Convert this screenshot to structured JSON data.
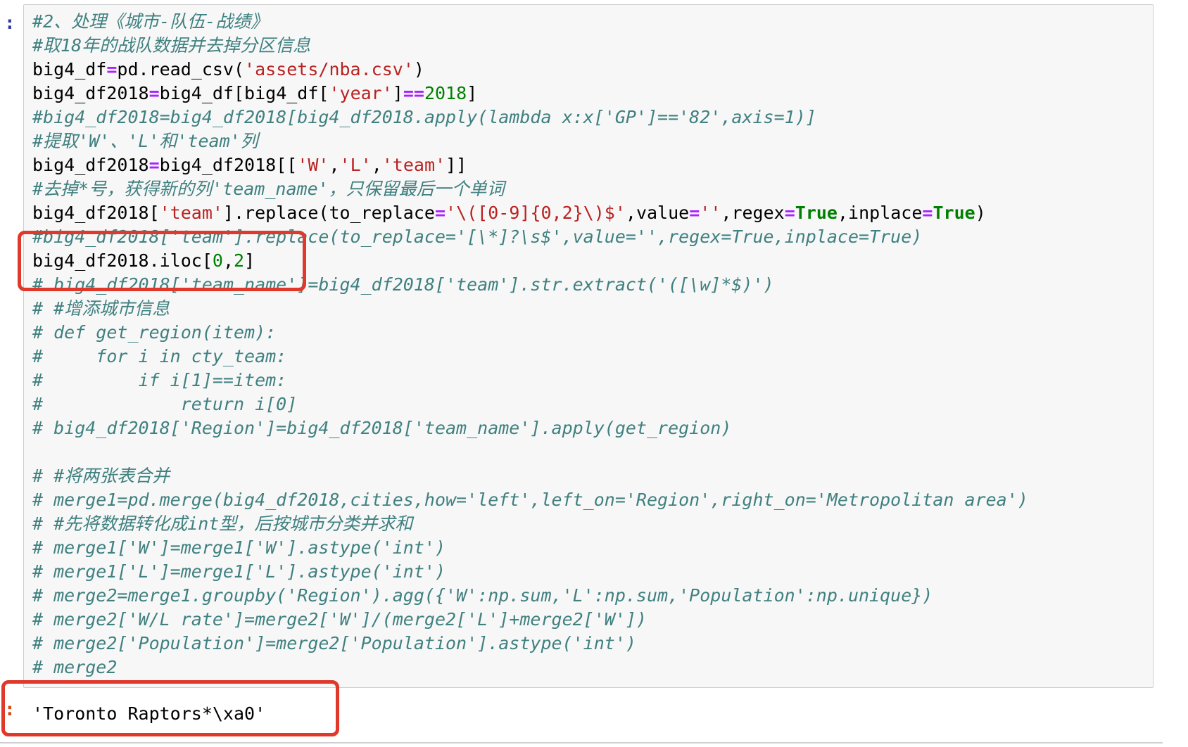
{
  "cell": {
    "input_prompt": ":",
    "output_prompt": ":",
    "output_text": "'Toronto Raptors*\\xa0'"
  },
  "code_lines": [
    [
      {
        "t": "#2、处理《城市-队伍-战绩》",
        "c": "c"
      }
    ],
    [
      {
        "t": "#取18年的战队数据并去掉分区信息",
        "c": "c"
      }
    ],
    [
      {
        "t": "big4_df"
      },
      {
        "t": "=",
        "c": "o"
      },
      {
        "t": "pd.read_csv("
      },
      {
        "t": "'assets/nba.csv'",
        "c": "s"
      },
      {
        "t": ")"
      }
    ],
    [
      {
        "t": "big4_df2018"
      },
      {
        "t": "=",
        "c": "o"
      },
      {
        "t": "big4_df[big4_df["
      },
      {
        "t": "'year'",
        "c": "s"
      },
      {
        "t": "]"
      },
      {
        "t": "==",
        "c": "o"
      },
      {
        "t": "2018",
        "c": "n"
      },
      {
        "t": "]"
      }
    ],
    [
      {
        "t": "#big4_df2018=big4_df2018[big4_df2018.apply(lambda x:x['GP']=='82',axis=1)]",
        "c": "c"
      }
    ],
    [
      {
        "t": "#提取'W'、'L'和'team'列",
        "c": "c"
      }
    ],
    [
      {
        "t": "big4_df2018"
      },
      {
        "t": "=",
        "c": "o"
      },
      {
        "t": "big4_df2018[["
      },
      {
        "t": "'W'",
        "c": "s"
      },
      {
        "t": ","
      },
      {
        "t": "'L'",
        "c": "s"
      },
      {
        "t": ","
      },
      {
        "t": "'team'",
        "c": "s"
      },
      {
        "t": "]]"
      }
    ],
    [
      {
        "t": "#去掉*号，获得新的列'team_name'，只保留最后一个单词",
        "c": "c"
      }
    ],
    [
      {
        "t": "big4_df2018["
      },
      {
        "t": "'team'",
        "c": "s"
      },
      {
        "t": "].replace(to_replace"
      },
      {
        "t": "=",
        "c": "o"
      },
      {
        "t": "'\\([0-9]{0,2}\\)$'",
        "c": "s"
      },
      {
        "t": ",value"
      },
      {
        "t": "=",
        "c": "o"
      },
      {
        "t": "''",
        "c": "s"
      },
      {
        "t": ",regex"
      },
      {
        "t": "=",
        "c": "o"
      },
      {
        "t": "True",
        "c": "k"
      },
      {
        "t": ",inplace"
      },
      {
        "t": "=",
        "c": "o"
      },
      {
        "t": "True",
        "c": "k"
      },
      {
        "t": ")"
      }
    ],
    [
      {
        "t": "#big4_df2018['team'].replace(to_replace='[\\*]?\\s$',value='',regex=True,inplace=True)",
        "c": "c"
      }
    ],
    [
      {
        "t": "big4_df2018.iloc["
      },
      {
        "t": "0",
        "c": "n"
      },
      {
        "t": ","
      },
      {
        "t": "2",
        "c": "n"
      },
      {
        "t": "]"
      }
    ],
    [
      {
        "t": "# big4_df2018['team_name']=big4_df2018['team'].str.extract('([\\w]*$)')",
        "c": "c"
      }
    ],
    [
      {
        "t": "# #增添城市信息",
        "c": "c"
      }
    ],
    [
      {
        "t": "# def get_region(item):",
        "c": "c"
      }
    ],
    [
      {
        "t": "#     for i in cty_team:",
        "c": "c"
      }
    ],
    [
      {
        "t": "#         if i[1]==item:",
        "c": "c"
      }
    ],
    [
      {
        "t": "#             return i[0]",
        "c": "c"
      }
    ],
    [
      {
        "t": "# big4_df2018['Region']=big4_df2018['team_name'].apply(get_region)",
        "c": "c"
      }
    ],
    [],
    [
      {
        "t": "# #将两张表合并",
        "c": "c"
      }
    ],
    [
      {
        "t": "# merge1=pd.merge(big4_df2018,cities,how='left',left_on='Region',right_on='Metropolitan area')",
        "c": "c"
      }
    ],
    [
      {
        "t": "# #先将数据转化成int型，后按城市分类并求和",
        "c": "c"
      }
    ],
    [
      {
        "t": "# merge1['W']=merge1['W'].astype('int')",
        "c": "c"
      }
    ],
    [
      {
        "t": "# merge1['L']=merge1['L'].astype('int')",
        "c": "c"
      }
    ],
    [
      {
        "t": "# merge2=merge1.groupby('Region').agg({'W':np.sum,'L':np.sum,'Population':np.unique})",
        "c": "c"
      }
    ],
    [
      {
        "t": "# merge2['W/L rate']=merge2['W']/(merge2['L']+merge2['W'])",
        "c": "c"
      }
    ],
    [
      {
        "t": "# merge2['Population']=merge2['Population'].astype('int')",
        "c": "c"
      }
    ],
    [
      {
        "t": "# merge2",
        "c": "c"
      }
    ]
  ],
  "colors": {
    "comment": "#408080",
    "string": "#ba2121",
    "operator": "#aa22ff",
    "number": "#008000",
    "keyword": "#008000",
    "prompt_in": "#303f9f",
    "prompt_out": "#d84315",
    "annotation": "#e0392b"
  }
}
